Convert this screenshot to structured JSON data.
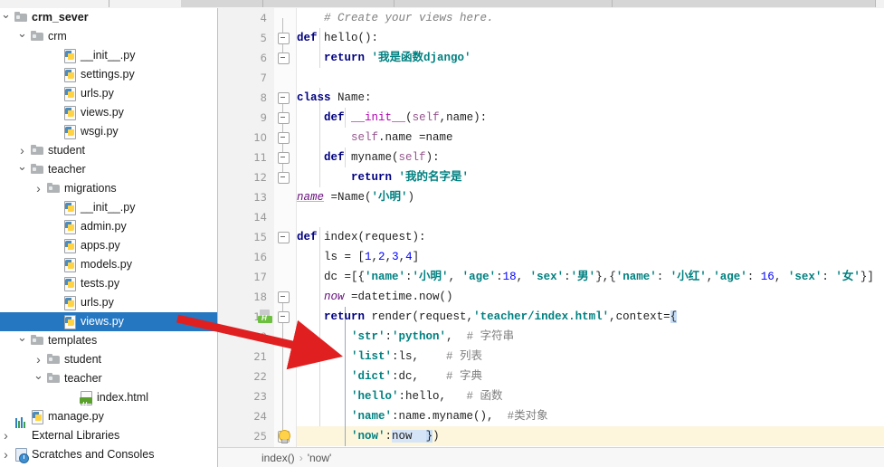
{
  "window": {
    "app": "PyCharm",
    "accent_selection": "#2577c2",
    "annotation_arrow_color": "#e02020"
  },
  "sidebar": {
    "name": "project-tree",
    "items": [
      {
        "label": "crm_sever",
        "path": "D:\\python\\crm_sever",
        "icon": "folder-icon",
        "depth": 0,
        "toggle": "open",
        "bold": true,
        "selected": false
      },
      {
        "label": "crm",
        "icon": "folder-icon",
        "depth": 1,
        "toggle": "open",
        "selected": false
      },
      {
        "label": "__init__.py",
        "icon": "python-file-icon",
        "depth": 3,
        "toggle": "none",
        "selected": false
      },
      {
        "label": "settings.py",
        "icon": "python-file-icon",
        "depth": 3,
        "toggle": "none",
        "selected": false
      },
      {
        "label": "urls.py",
        "icon": "python-file-icon",
        "depth": 3,
        "toggle": "none",
        "selected": false
      },
      {
        "label": "views.py",
        "icon": "python-file-icon",
        "depth": 3,
        "toggle": "none",
        "selected": false
      },
      {
        "label": "wsgi.py",
        "icon": "python-file-icon",
        "depth": 3,
        "toggle": "none",
        "selected": false
      },
      {
        "label": "student",
        "icon": "folder-icon",
        "depth": 1,
        "toggle": "closed",
        "selected": false
      },
      {
        "label": "teacher",
        "icon": "folder-icon",
        "depth": 1,
        "toggle": "open",
        "selected": false
      },
      {
        "label": "migrations",
        "icon": "folder-icon",
        "depth": 2,
        "toggle": "closed",
        "selected": false
      },
      {
        "label": "__init__.py",
        "icon": "python-file-icon",
        "depth": 3,
        "toggle": "none",
        "selected": false
      },
      {
        "label": "admin.py",
        "icon": "python-file-icon",
        "depth": 3,
        "toggle": "none",
        "selected": false
      },
      {
        "label": "apps.py",
        "icon": "python-file-icon",
        "depth": 3,
        "toggle": "none",
        "selected": false
      },
      {
        "label": "models.py",
        "icon": "python-file-icon",
        "depth": 3,
        "toggle": "none",
        "selected": false
      },
      {
        "label": "tests.py",
        "icon": "python-file-icon",
        "depth": 3,
        "toggle": "none",
        "selected": false
      },
      {
        "label": "urls.py",
        "icon": "python-file-icon",
        "depth": 3,
        "toggle": "none",
        "selected": false
      },
      {
        "label": "views.py",
        "icon": "python-file-icon",
        "depth": 3,
        "toggle": "none",
        "selected": true
      },
      {
        "label": "templates",
        "icon": "folder-icon",
        "depth": 1,
        "toggle": "open",
        "selected": false
      },
      {
        "label": "student",
        "icon": "folder-icon",
        "depth": 2,
        "toggle": "closed",
        "selected": false
      },
      {
        "label": "teacher",
        "icon": "folder-icon",
        "depth": 2,
        "toggle": "open",
        "selected": false
      },
      {
        "label": "index.html",
        "icon": "html-file-icon",
        "depth": 4,
        "toggle": "none",
        "selected": false
      },
      {
        "label": "manage.py",
        "icon": "python-file-icon",
        "depth": 1,
        "toggle": "none",
        "selected": false
      },
      {
        "label": "External Libraries",
        "icon": "libraries-icon",
        "depth": 0,
        "toggle": "closed",
        "selected": false
      },
      {
        "label": "Scratches and Consoles",
        "icon": "scratches-icon",
        "depth": 0,
        "toggle": "closed",
        "selected": false
      }
    ]
  },
  "editor": {
    "name": "code-editor",
    "first_visible_line": 4,
    "caret_line": 25,
    "gutter_icons": [
      {
        "line": 19,
        "icon": "html-template-gutter-icon"
      },
      {
        "line": 25,
        "icon": "intention-bulb-icon"
      }
    ],
    "lines": [
      {
        "n": 4,
        "text": "    # Create your views here."
      },
      {
        "n": 5,
        "text": "def hello():"
      },
      {
        "n": 6,
        "text": "    return '我是函数django'"
      },
      {
        "n": 7,
        "text": ""
      },
      {
        "n": 8,
        "text": "class Name:"
      },
      {
        "n": 9,
        "text": "    def __init__(self,name):"
      },
      {
        "n": 10,
        "text": "        self.name =name"
      },
      {
        "n": 11,
        "text": "    def myname(self):"
      },
      {
        "n": 12,
        "text": "        return '我的名字是'"
      },
      {
        "n": 13,
        "text": "name =Name('小明')"
      },
      {
        "n": 14,
        "text": ""
      },
      {
        "n": 15,
        "text": "def index(request):"
      },
      {
        "n": 16,
        "text": "    ls = [1,2,3,4]"
      },
      {
        "n": 17,
        "text": "    dc =[{'name':'小明', 'age':18, 'sex':'男'},{'name': '小红','age': 16, 'sex': '女'}]"
      },
      {
        "n": 18,
        "text": "    now =datetime.now()"
      },
      {
        "n": 19,
        "text": "    return render(request,'teacher/index.html',context={"
      },
      {
        "n": 20,
        "text": "        'str':'python',  # 字符串"
      },
      {
        "n": 21,
        "text": "        'list':ls,    # 列表"
      },
      {
        "n": 22,
        "text": "        'dict':dc,    # 字典"
      },
      {
        "n": 23,
        "text": "        'hello':hello,   # 函数"
      },
      {
        "n": 24,
        "text": "        'name':name.myname(),  #类对象"
      },
      {
        "n": 25,
        "text": "        'now':now  })"
      }
    ]
  },
  "statusbar": {
    "name": "breadcrumb-bar",
    "crumb_function": "index()",
    "crumb_separator": "›",
    "crumb_key": "'now'"
  }
}
